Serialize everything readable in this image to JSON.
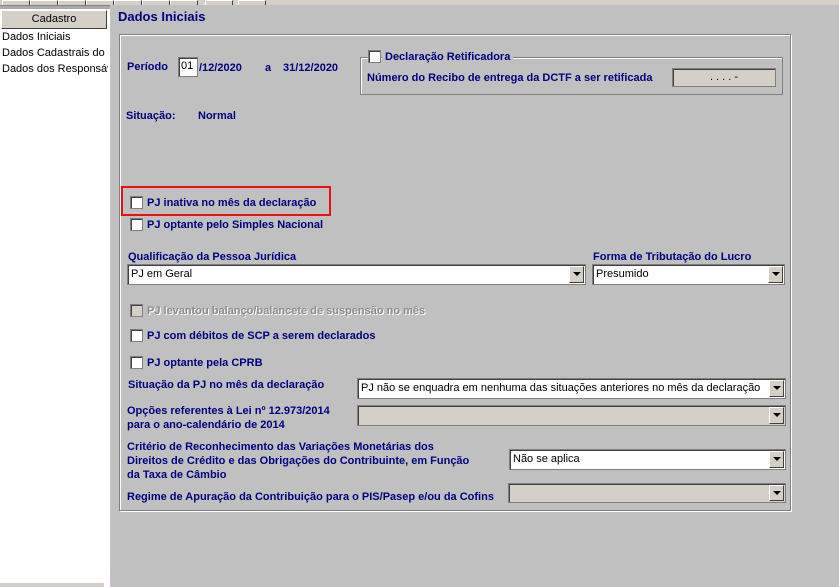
{
  "sidebar": {
    "tab_label": "Cadastro",
    "items": [
      "Dados Iniciais",
      "Dados Cadastrais do E",
      "Dados dos Responsáv"
    ]
  },
  "header": {
    "title": "Dados Iniciais"
  },
  "periodo": {
    "label": "Período",
    "day_value": "01",
    "start_rest": "/12/2020",
    "sep": "a",
    "end": "31/12/2020"
  },
  "retificadora": {
    "label": "Declaração Retificadora",
    "recibo_label": "Número do Recibo de entrega da DCTF a ser retificada",
    "recibo_value": ". . . . -"
  },
  "situacao": {
    "label": "Situação:",
    "value": "Normal"
  },
  "checks": {
    "inativa": "PJ inativa no mês da declaração",
    "simples": "PJ optante pelo Simples Nacional",
    "balanco": "PJ levantou balanço/balancete de suspensão no mês",
    "scp": "PJ com débitos de SCP a serem declarados",
    "cprb": "PJ optante pela CPRB"
  },
  "qualificacao": {
    "label": "Qualificação da Pessoa Jurídica",
    "value": "PJ em Geral"
  },
  "tributacao": {
    "label": "Forma de Tributação do Lucro",
    "value": "Presumido"
  },
  "situacao_pj": {
    "label": "Situação da PJ no mês da declaração",
    "value": "PJ não se enquadra em nenhuma das situações anteriores no mês da declaração"
  },
  "opcoes_lei": {
    "label_line1": "Opções referentes à Lei nº 12.973/2014",
    "label_line2": "para o ano-calendário de 2014",
    "value": ""
  },
  "criterio": {
    "label_line1": "Critério de Reconhecimento das Variações Monetárias dos",
    "label_line2": "Direitos de Crédito e das Obrigações do Contribuinte, em Função",
    "label_line3": "da Taxa de Câmbio",
    "value": "Não se aplica"
  },
  "regime": {
    "label": "Regime de Apuração da Contribuição para o PIS/Pasep e/ou da Cofins",
    "value": ""
  }
}
